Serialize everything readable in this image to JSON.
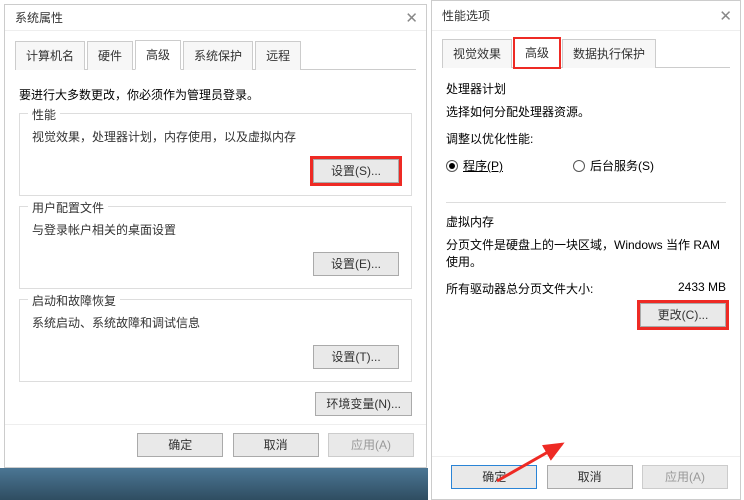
{
  "left": {
    "title": "系统属性",
    "tabs": [
      "计算机名",
      "硬件",
      "高级",
      "系统保护",
      "远程"
    ],
    "note": "要进行大多数更改，你必须作为管理员登录。",
    "group_perf": {
      "legend": "性能",
      "desc": "视觉效果，处理器计划，内存使用，以及虚拟内存",
      "btn": "设置(S)..."
    },
    "group_profile": {
      "legend": "用户配置文件",
      "desc": "与登录帐户相关的桌面设置",
      "btn": "设置(E)..."
    },
    "group_startup": {
      "legend": "启动和故障恢复",
      "desc": "系统启动、系统故障和调试信息",
      "btn": "设置(T)..."
    },
    "env_btn": "环境变量(N)...",
    "footer": {
      "ok": "确定",
      "cancel": "取消",
      "apply": "应用(A)"
    }
  },
  "right": {
    "title": "性能选项",
    "tabs": [
      "视觉效果",
      "高级",
      "数据执行保护"
    ],
    "cpu": {
      "title": "处理器计划",
      "desc": "选择如何分配处理器资源。",
      "adjust": "调整以优化性能:",
      "radio_prog": "程序(P)",
      "radio_bg": "后台服务(S)"
    },
    "vm": {
      "title": "虚拟内存",
      "desc": "分页文件是硬盘上的一块区域，Windows 当作 RAM 使用。",
      "total_label": "所有驱动器总分页文件大小:",
      "total_value": "2433 MB",
      "change_btn": "更改(C)..."
    },
    "footer": {
      "ok": "确定",
      "cancel": "取消",
      "apply": "应用(A)"
    }
  }
}
